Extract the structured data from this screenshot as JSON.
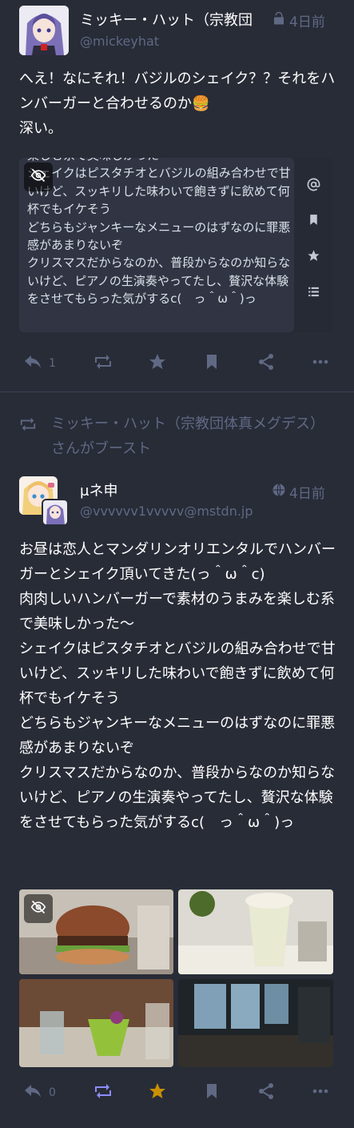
{
  "status1": {
    "display_name": "ミッキー・ハット（宗教団体真メグデス）",
    "acct": "@mickeyhat",
    "time": "4日前",
    "visibility_icon": "unlock-icon",
    "content_lines": [
      "へえ！なにそれ！バジルのシェイク？？それをハンバーガーと合わせるのか🍔",
      "深い。"
    ],
    "quote_lines": [
      "楽しむ系で美味しかった〜",
      "シェイクはピスタチオとバジルの組み合わせで甘いけど、スッキリした味わいで飽きずに飲めて何杯でもイケそう",
      "どちらもジャンキーなメニューのはずなのに罪悪感があまりないぞ",
      "クリスマスだからなのか、普段からなのか知らないけど、ピアノの生演奏やってたし、贅沢な体験をさせてもらった気がするc(　っ＾ω＾)っ"
    ],
    "reply_count": "1",
    "rail_icons": [
      "at-icon",
      "bookmark-icon",
      "star-icon",
      "list-icon"
    ]
  },
  "status2": {
    "boost_text": "ミッキー・ハット（宗教団体真メグデス）さんがブースト",
    "display_name": "μネ申",
    "acct": "@vvvvvv1vvvvv@mstdn.jp",
    "time": "4日前",
    "visibility_icon": "globe-icon",
    "content_lines": [
      "お昼は恋人とマンダリンオリエンタルでハンバーガーとシェイク頂いてきた(っ＾ω＾c)",
      "肉肉しいハンバーガーで素材のうまみを楽しむ系で美味しかった〜",
      "シェイクはピスタチオとバジルの組み合わせで甘いけど、スッキリした味わいで飽きずに飲めて何杯でもイケそう",
      "どちらもジャンキーなメニューのはずなのに罪悪感があまりないぞ",
      "クリスマスだからなのか、普段からなのか知らないけど、ピアノの生演奏やってたし、贅沢な体験をさせてもらった気がするc(　っ＾ω＾)っ"
    ],
    "reply_count": "0",
    "boosted": true,
    "favourited": true,
    "media": [
      "burger-photo",
      "shake-photo",
      "green-drink-photo",
      "restaurant-interior-photo"
    ]
  },
  "colors": {
    "background": "#282c37",
    "text": "#ffffff",
    "muted": "#606984",
    "boost_active": "#8c8dff",
    "favourite_active": "#ca8f04"
  }
}
